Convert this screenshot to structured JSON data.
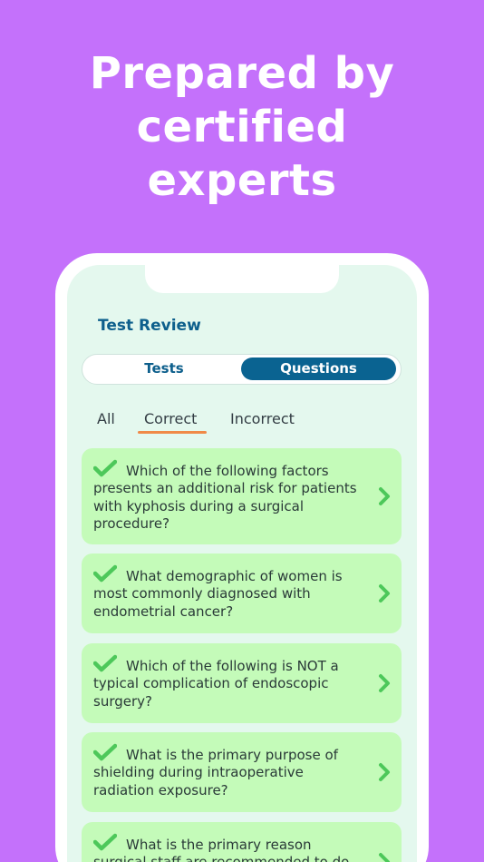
{
  "headline": {
    "line1": "Prepared by",
    "line2": "certified",
    "line3": "experts"
  },
  "screen": {
    "title": "Test Review",
    "segments": {
      "tests": "Tests",
      "questions": "Questions",
      "selected": "Questions"
    },
    "filters": {
      "all": "All",
      "correct": "Correct",
      "incorrect": "Incorrect",
      "selected": "Correct"
    },
    "questions": [
      {
        "text": "Which of the following factors presents an additional risk for patients with kyphosis during a surgical procedure?",
        "status": "correct"
      },
      {
        "text": "What demographic of women is most commonly diagnosed with endometrial cancer?",
        "status": "correct"
      },
      {
        "text": "Which of the following is NOT a typical complication of endoscopic surgery?",
        "status": "correct"
      },
      {
        "text": "What is the primary purpose of shielding during intraoperative radiation exposure?",
        "status": "correct"
      },
      {
        "text": "What is the primary reason surgical staff are recommended to do",
        "status": "correct"
      }
    ]
  },
  "colors": {
    "background": "#c471fb",
    "card": "#c4fbb9",
    "accent_blue": "#0a6391",
    "check_green": "#4dc85a",
    "underline_orange": "#f08a48"
  },
  "icons": {
    "check": "check-icon",
    "chevron": "chevron-right-icon"
  }
}
